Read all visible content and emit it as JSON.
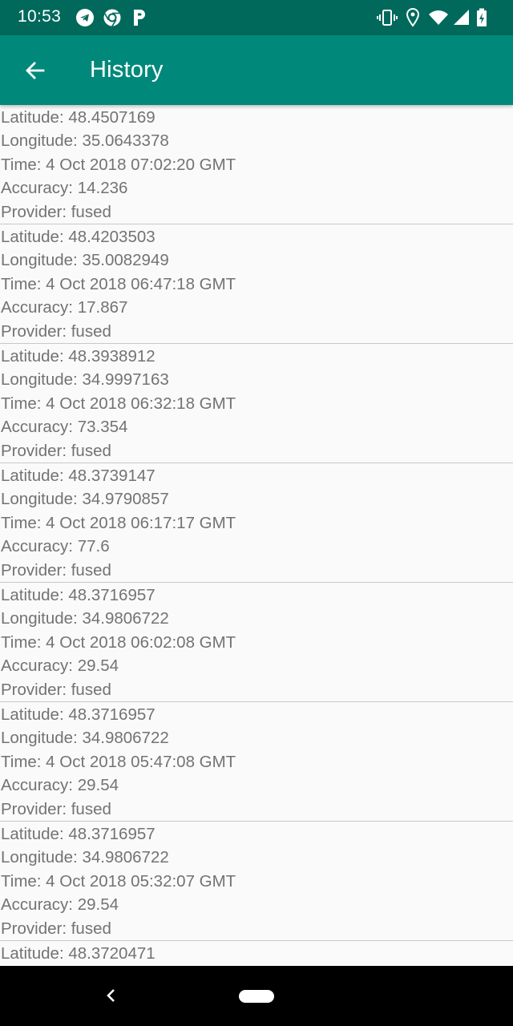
{
  "status_bar": {
    "time": "10:53",
    "left_icons": [
      "telegram-icon",
      "chrome-icon",
      "parking-icon"
    ],
    "right_icons": [
      "vibrate-icon",
      "location-icon",
      "wifi-icon",
      "signal-icon",
      "battery-charging-icon"
    ]
  },
  "app_bar": {
    "title": "History",
    "back_icon": "arrow-back-icon"
  },
  "colors": {
    "status_bar": "#00695c",
    "app_bar": "#00897b",
    "text": "#737373",
    "divider": "#c8c8c8",
    "background": "#fafafa"
  },
  "records": [
    {
      "latitude": "Latitude: 48.4507169",
      "longitude": "Longitude: 35.0643378",
      "time": "Time: 4 Oct 2018 07:02:20 GMT",
      "accuracy": "Accuracy: 14.236",
      "provider": "Provider: fused"
    },
    {
      "latitude": "Latitude: 48.4203503",
      "longitude": "Longitude: 35.0082949",
      "time": "Time: 4 Oct 2018 06:47:18 GMT",
      "accuracy": "Accuracy: 17.867",
      "provider": "Provider: fused"
    },
    {
      "latitude": "Latitude: 48.3938912",
      "longitude": "Longitude: 34.9997163",
      "time": "Time: 4 Oct 2018 06:32:18 GMT",
      "accuracy": "Accuracy: 73.354",
      "provider": "Provider: fused"
    },
    {
      "latitude": "Latitude: 48.3739147",
      "longitude": "Longitude: 34.9790857",
      "time": "Time: 4 Oct 2018 06:17:17 GMT",
      "accuracy": "Accuracy: 77.6",
      "provider": "Provider: fused"
    },
    {
      "latitude": "Latitude: 48.3716957",
      "longitude": "Longitude: 34.9806722",
      "time": "Time: 4 Oct 2018 06:02:08 GMT",
      "accuracy": "Accuracy: 29.54",
      "provider": "Provider: fused"
    },
    {
      "latitude": "Latitude: 48.3716957",
      "longitude": "Longitude: 34.9806722",
      "time": "Time: 4 Oct 2018 05:47:08 GMT",
      "accuracy": "Accuracy: 29.54",
      "provider": "Provider: fused"
    },
    {
      "latitude": "Latitude: 48.3716957",
      "longitude": "Longitude: 34.9806722",
      "time": "Time: 4 Oct 2018 05:32:07 GMT",
      "accuracy": "Accuracy: 29.54",
      "provider": "Provider: fused"
    },
    {
      "latitude": "Latitude: 48.3720471"
    }
  ],
  "nav_bar": {
    "back_icon": "nav-back-icon",
    "home_icon": "nav-home-pill-icon"
  }
}
